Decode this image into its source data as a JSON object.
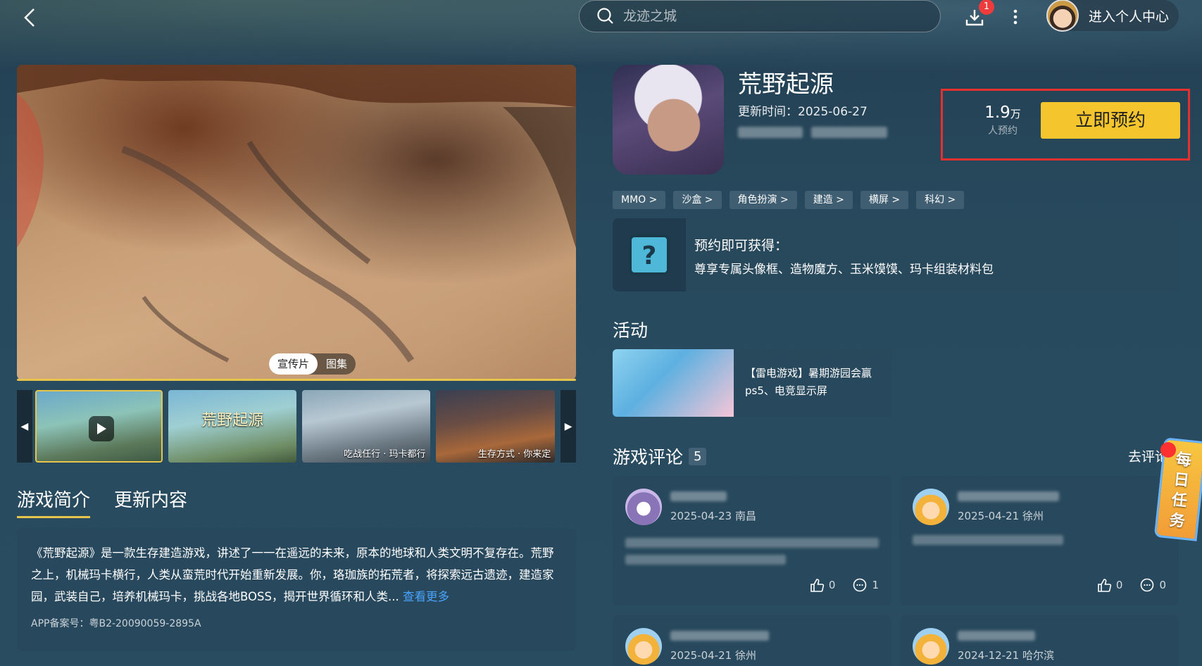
{
  "header": {
    "search_placeholder": "龙迹之城",
    "download_badge": "1",
    "user_center_label": "进入个人中心"
  },
  "media": {
    "tabs": [
      "宣传片",
      "图集"
    ],
    "thumbnails": [
      {
        "caption": ""
      },
      {
        "caption": "荒野起源"
      },
      {
        "caption": "吃战任行 · 玛卡都行"
      },
      {
        "caption": "生存方式 · 你来定"
      }
    ]
  },
  "intro": {
    "tabs": [
      "游戏简介",
      "更新内容"
    ],
    "text": "《荒野起源》是一款生存建造游戏，讲述了一一在遥远的未来，原本的地球和人类文明不复存在。荒野之上，机械玛卡横行，人类从蛮荒时代开始重新发展。你，珞珈族的拓荒者，将探索远古遗迹，建造家园，武装自己，培养机械玛卡，挑战各地BOSS，揭开世界循环和人类...",
    "see_more": "查看更多",
    "icp": "APP备案号：粤B2-20090059-2895A"
  },
  "game": {
    "title": "荒野起源",
    "update_time": "更新时间：2025-06-27",
    "reserve_count": "1.9",
    "reserve_unit": "万",
    "reserve_label": "人预约",
    "reserve_button": "立即预约",
    "tags": [
      "MMO >",
      "沙盒 >",
      "角色扮演 >",
      "建造 >",
      "横屏 >",
      "科幻 >"
    ]
  },
  "perk": {
    "title": "预约即可获得：",
    "desc": "尊享专属头像框、造物魔方、玉米馍馍、玛卡组装材料包"
  },
  "activity": {
    "section_title": "活动",
    "text": "【雷电游戏】暑期游园会赢ps5、电竞显示屏"
  },
  "comments": {
    "section_title": "游戏评论",
    "count": "5",
    "go_comment": "去评论",
    "items": [
      {
        "meta": "2025-04-23 南昌",
        "likes": "0",
        "replies": "1"
      },
      {
        "meta": "2025-04-21 徐州",
        "likes": "0",
        "replies": "0"
      },
      {
        "meta": "2025-04-21 徐州"
      },
      {
        "meta": "2024-12-21 哈尔滨"
      }
    ]
  },
  "daily_task": {
    "label": "每日任务"
  }
}
